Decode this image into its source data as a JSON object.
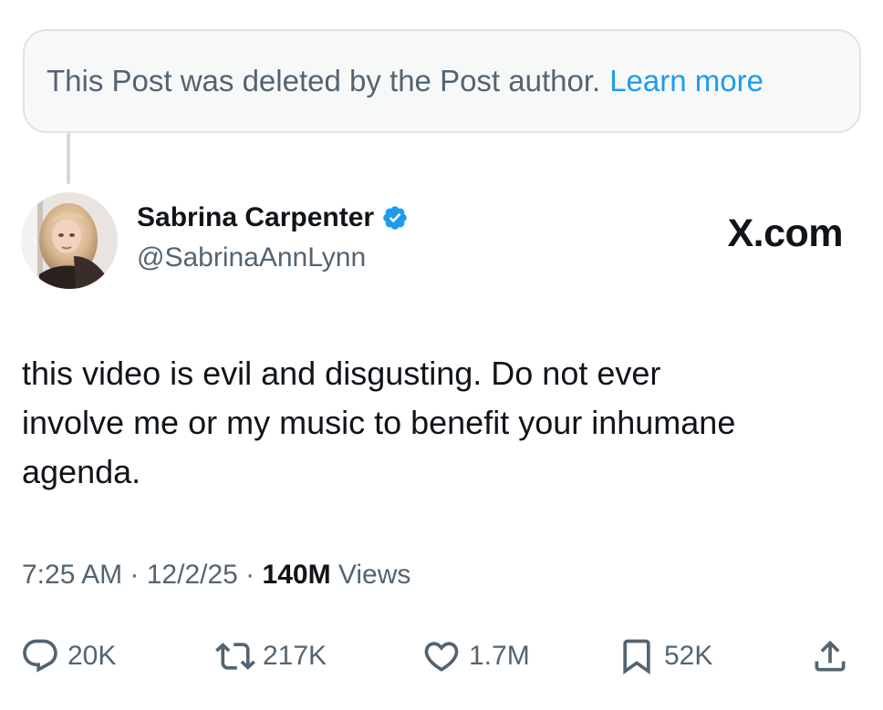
{
  "deleted_notice": {
    "text": "This Post was deleted by the Post author.",
    "link": "Learn more"
  },
  "author": {
    "name": "Sabrina Carpenter",
    "handle": "@SabrinaAnnLynn",
    "verified": true
  },
  "brand": {
    "watermark": "X.com"
  },
  "post": {
    "lines": [
      "this video is evil and disgusting. Do not ever",
      "involve me or my music to benefit your inhumane",
      "agenda."
    ]
  },
  "meta": {
    "time": "7:25 AM",
    "date": "12/2/25",
    "views_count": "140M",
    "views_label": "Views"
  },
  "actions": {
    "replies": "20K",
    "reposts": "217K",
    "likes": "1.7M",
    "bookmarks": "52K"
  },
  "colors": {
    "text": "#0f1419",
    "secondary": "#536471",
    "link": "#1d9bf0",
    "verified": "#1d9bf0"
  },
  "icons": [
    "verified-badge-icon",
    "reply-icon",
    "repost-icon",
    "like-icon",
    "bookmark-icon",
    "share-icon"
  ]
}
